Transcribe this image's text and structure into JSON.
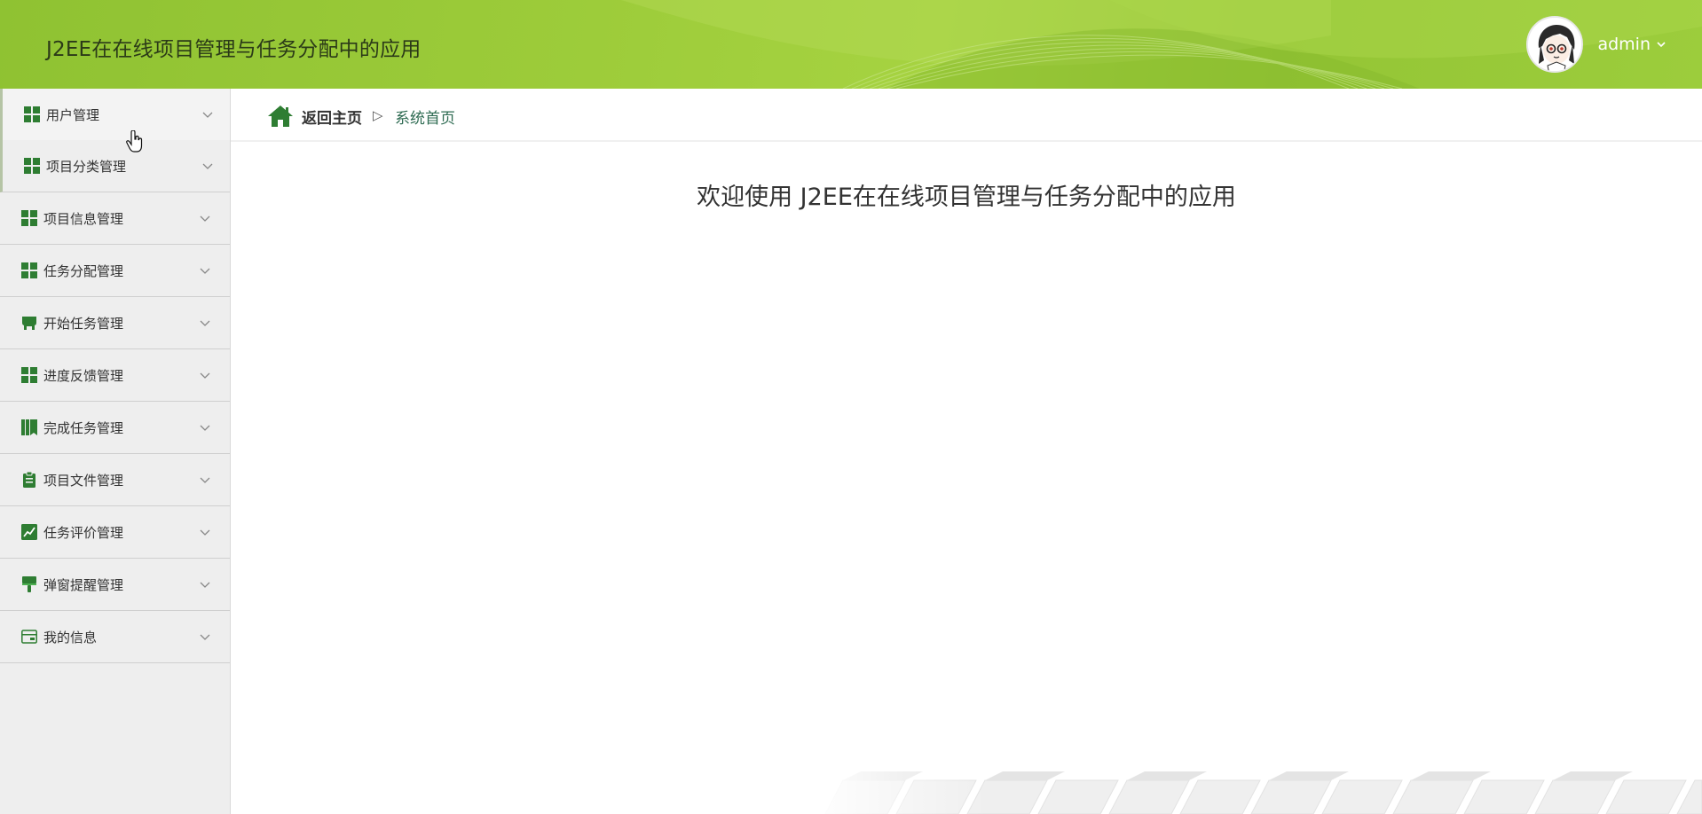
{
  "header": {
    "title": "J2EE在在线项目管理与任务分配中的应用",
    "username": "admin",
    "avatar_icon": "avatar-icon",
    "colors": {
      "bar": "#9dcc3a",
      "title": "#2b3a18"
    }
  },
  "sidebar": {
    "items": [
      {
        "label": "用户管理",
        "icon": "grid-icon"
      },
      {
        "label": "项目分类管理",
        "icon": "grid-icon"
      },
      {
        "label": "项目信息管理",
        "icon": "grid-icon"
      },
      {
        "label": "任务分配管理",
        "icon": "grid-icon"
      },
      {
        "label": "开始任务管理",
        "icon": "store-icon"
      },
      {
        "label": "进度反馈管理",
        "icon": "grid-icon"
      },
      {
        "label": "完成任务管理",
        "icon": "book-icon"
      },
      {
        "label": "项目文件管理",
        "icon": "clipboard-icon"
      },
      {
        "label": "任务评价管理",
        "icon": "chart-icon"
      },
      {
        "label": "弹窗提醒管理",
        "icon": "brush-icon"
      },
      {
        "label": "我的信息",
        "icon": "card-icon"
      }
    ],
    "icon_color": "#2e7d32"
  },
  "breadcrumb": {
    "home_label": "返回主页",
    "separator": "▷",
    "current_label": "系统首页",
    "home_icon": "home-icon"
  },
  "main": {
    "welcome_text": "欢迎使用 J2EE在在线项目管理与任务分配中的应用"
  }
}
